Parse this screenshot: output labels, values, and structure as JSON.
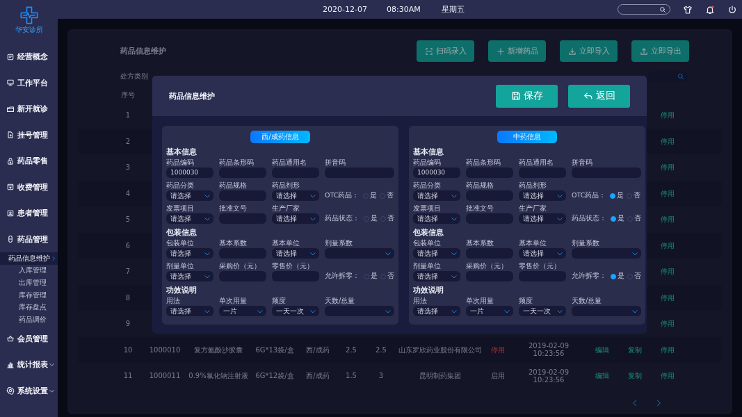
{
  "clinic": {
    "name": "华安诊所"
  },
  "topbar": {
    "date": "2020-12-07",
    "time": "08:30AM",
    "weekday": "星期五"
  },
  "sidebar": {
    "items": [
      {
        "label": "经营概念"
      },
      {
        "label": "工作平台"
      },
      {
        "label": "新开就诊"
      },
      {
        "label": "挂号管理"
      },
      {
        "label": "药品零售"
      },
      {
        "label": "收费管理"
      },
      {
        "label": "患者管理"
      },
      {
        "label": "药品管理",
        "expanded": true,
        "children": [
          {
            "label": "药品信息维护",
            "selected": true
          },
          {
            "label": "入库管理",
            "selected": false
          },
          {
            "label": "出库管理",
            "selected": false
          },
          {
            "label": "库存管理",
            "selected": false
          },
          {
            "label": "库存盘点",
            "selected": false
          },
          {
            "label": "药品调价",
            "selected": false
          }
        ]
      },
      {
        "label": "会员管理"
      },
      {
        "label": "统计报表",
        "expanded": false
      },
      {
        "label": "系统设置",
        "expanded": false
      }
    ]
  },
  "page": {
    "title": "药品信息维护",
    "actions": [
      "扫码录入",
      "新增药品",
      "立即导入",
      "立即导出"
    ],
    "filter_label": "处方类别",
    "table": {
      "columns": [
        "序号"
      ],
      "rows": [
        {
          "index": "1",
          "action": "停用"
        },
        {
          "index": "2",
          "action": "停用"
        },
        {
          "index": "3",
          "action": "停用"
        },
        {
          "index": "4",
          "action": "停用"
        },
        {
          "index": "5",
          "action": "停用"
        },
        {
          "index": "6",
          "action": "停用"
        },
        {
          "index": "7",
          "action": "停用"
        },
        {
          "index": "8",
          "action": "停用"
        },
        {
          "index": "9",
          "action": "停用"
        },
        {
          "index": "10",
          "code": "1000010",
          "name": "复方氨酚沙胶囊",
          "spec": "6G*13袋/盒",
          "type": "西/成药",
          "purchase_price": "2.5",
          "retail_price": "2.5",
          "maker": "山东罗欣药业股份有限公司",
          "status": "停用",
          "enabled": false,
          "time": "2019-02-09 10:23:56",
          "edit": "编辑",
          "copy": "复制",
          "action": "停用"
        },
        {
          "index": "11",
          "code": "1000011",
          "name": "0.9%氯化钠注射液",
          "spec": "6G*12袋/盒",
          "type": "西/成药",
          "purchase_price": "1.5",
          "retail_price": "3",
          "maker": "昆明制药集团",
          "status": "启用",
          "enabled": true,
          "time": "2019-02-09 10:23:56",
          "edit": "编辑",
          "copy": "复制",
          "action": "停用"
        }
      ]
    }
  },
  "modal": {
    "title": "药品信息维护",
    "buttons": [
      {
        "kind": "save",
        "label": "保存"
      },
      {
        "kind": "back",
        "label": "返回"
      }
    ],
    "panels": [
      {
        "title": "西/成药信息",
        "sections": [
          {
            "title": "基本信息",
            "fields": [
              {
                "kind": "input",
                "label": "药品编码",
                "value": "1000030"
              },
              {
                "kind": "input",
                "label": "药品条形码"
              },
              {
                "kind": "input",
                "label": "药品通用名"
              },
              {
                "kind": "input",
                "label": "拼音码"
              },
              {
                "kind": "select",
                "label": "药品分类",
                "value": "请选择"
              },
              {
                "kind": "input",
                "label": "药品规格"
              },
              {
                "kind": "select",
                "label": "药品剂形",
                "value": "请选择"
              },
              {
                "kind": "radio",
                "label": "OTC药品：",
                "options": [
                  {
                    "label": "是",
                    "selected": false
                  },
                  {
                    "label": "否",
                    "selected": false
                  }
                ]
              },
              {
                "kind": "select",
                "label": "发票项目",
                "value": "请选择"
              },
              {
                "kind": "input",
                "label": "批准文号"
              },
              {
                "kind": "select",
                "label": "生产厂家",
                "value": "请选择"
              },
              {
                "kind": "radio",
                "label": "药品状态：",
                "options": [
                  {
                    "label": "是",
                    "selected": false
                  },
                  {
                    "label": "否",
                    "selected": false
                  }
                ]
              }
            ]
          },
          {
            "title": "包装信息",
            "fields": [
              {
                "kind": "select",
                "label": "包装单位",
                "value": "请选择"
              },
              {
                "kind": "input",
                "label": "基本系数"
              },
              {
                "kind": "select",
                "label": "基本单位",
                "value": "请选择"
              },
              {
                "kind": "select",
                "label": "剂量系数"
              },
              {
                "kind": "select",
                "label": "剂量单位",
                "value": "请选择"
              },
              {
                "kind": "input",
                "label": "采购价（元）"
              },
              {
                "kind": "input",
                "label": "零售价（元）"
              },
              {
                "kind": "radio",
                "label": "允许拆零：",
                "options": [
                  {
                    "label": "是",
                    "selected": false
                  },
                  {
                    "label": "否",
                    "selected": false
                  }
                ]
              }
            ]
          },
          {
            "title": "功效说明",
            "fields": [
              {
                "kind": "select",
                "label": "用法",
                "value": "请选择"
              },
              {
                "kind": "select",
                "label": "单次用量",
                "value": "一片"
              },
              {
                "kind": "select",
                "label": "频度",
                "value": "一天一次"
              },
              {
                "kind": "select",
                "label": "天数/总量"
              }
            ]
          }
        ]
      },
      {
        "title": "中药信息",
        "sections": [
          {
            "title": "基本信息",
            "fields": [
              {
                "kind": "input",
                "label": "药品编码",
                "value": "1000030"
              },
              {
                "kind": "input",
                "label": "药品条形码"
              },
              {
                "kind": "input",
                "label": "药品通用名"
              },
              {
                "kind": "input",
                "label": "拼音码"
              },
              {
                "kind": "select",
                "label": "药品分类",
                "value": "请选择"
              },
              {
                "kind": "input",
                "label": "药品规格"
              },
              {
                "kind": "select",
                "label": "药品剂形",
                "value": "请选择"
              },
              {
                "kind": "radio",
                "label": "OTC药品：",
                "options": [
                  {
                    "label": "是",
                    "selected": true
                  },
                  {
                    "label": "否",
                    "selected": false
                  }
                ]
              },
              {
                "kind": "select",
                "label": "发票项目",
                "value": "请选择"
              },
              {
                "kind": "input",
                "label": "批准文号"
              },
              {
                "kind": "select",
                "label": "生产厂家",
                "value": "请选择"
              },
              {
                "kind": "radio",
                "label": "药品状态：",
                "options": [
                  {
                    "label": "是",
                    "selected": true
                  },
                  {
                    "label": "否",
                    "selected": false
                  }
                ]
              }
            ]
          },
          {
            "title": "包装信息",
            "fields": [
              {
                "kind": "select",
                "label": "包装单位",
                "value": "请选择"
              },
              {
                "kind": "input",
                "label": "基本系数"
              },
              {
                "kind": "select",
                "label": "基本单位",
                "value": "请选择"
              },
              {
                "kind": "select",
                "label": "剂量系数"
              },
              {
                "kind": "select",
                "label": "剂量单位",
                "value": "请选择"
              },
              {
                "kind": "input",
                "label": "采购价（元）"
              },
              {
                "kind": "input",
                "label": "零售价（元）"
              },
              {
                "kind": "radio",
                "label": "允许拆零：",
                "options": [
                  {
                    "label": "是",
                    "selected": true
                  },
                  {
                    "label": "否",
                    "selected": false
                  }
                ]
              }
            ]
          },
          {
            "title": "功效说明",
            "fields": [
              {
                "kind": "select",
                "label": "用法",
                "value": "请选择"
              },
              {
                "kind": "select",
                "label": "单次用量",
                "value": "一片"
              },
              {
                "kind": "select",
                "label": "频度",
                "value": "一天一次"
              },
              {
                "kind": "select",
                "label": "天数/总量"
              }
            ]
          }
        ]
      }
    ]
  }
}
